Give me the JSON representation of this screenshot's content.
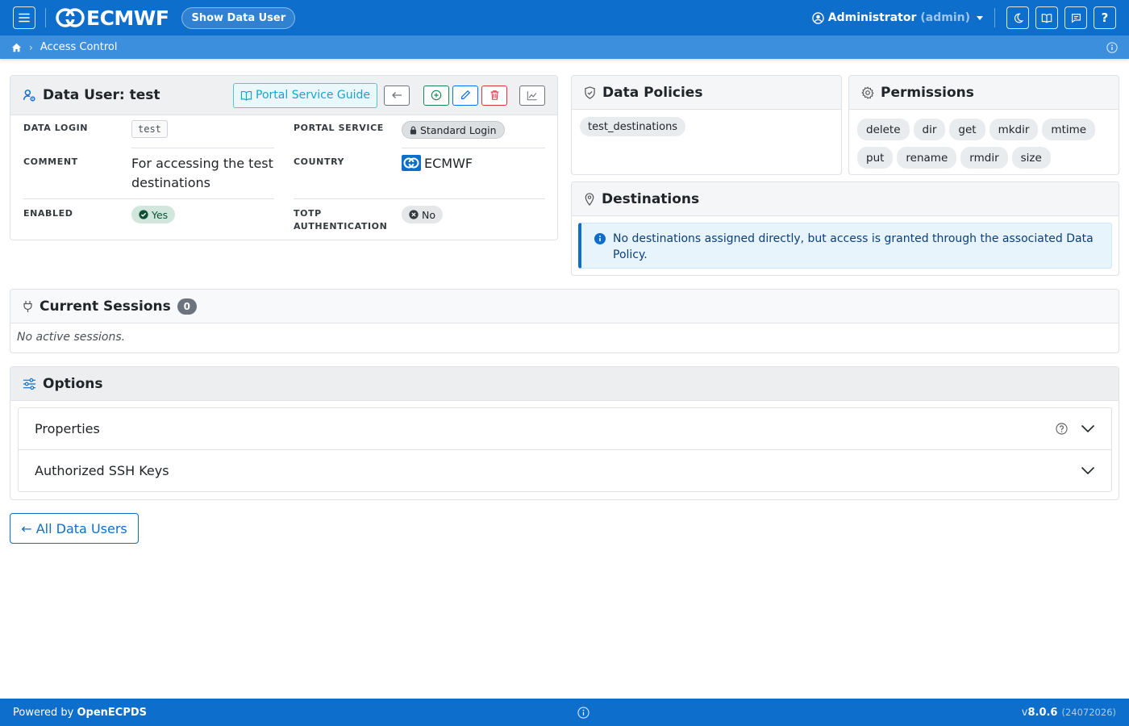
{
  "header": {
    "brand": "ECMWF",
    "page_pill": "Show Data User",
    "user_name": "Administrator",
    "user_role": "(admin)"
  },
  "breadcrumb": {
    "current": "Access Control"
  },
  "data_user": {
    "title": "Data User: test",
    "guide_label": "Portal Service Guide",
    "fields": {
      "data_login_label": "DATA LOGIN",
      "data_login_value": "test",
      "portal_service_label": "PORTAL SERVICE",
      "portal_service_value": "Standard Login",
      "comment_label": "COMMENT",
      "comment_value": "For accessing the test destinations",
      "country_label": "COUNTRY",
      "country_value": "ECMWF",
      "enabled_label": "ENABLED",
      "enabled_value": "Yes",
      "totp_label_1": "TOTP",
      "totp_label_2": "AUTHENTICATION",
      "totp_value": "No"
    }
  },
  "data_policies": {
    "title": "Data Policies",
    "items": [
      "test_destinations"
    ]
  },
  "permissions": {
    "title": "Permissions",
    "items": [
      "delete",
      "dir",
      "get",
      "mkdir",
      "mtime",
      "put",
      "rename",
      "rmdir",
      "size"
    ]
  },
  "destinations": {
    "title": "Destinations",
    "alert": "No destinations assigned directly, but access is granted through the associated Data Policy."
  },
  "sessions": {
    "title": "Current Sessions",
    "count": "0",
    "empty": "No active sessions."
  },
  "options": {
    "title": "Options",
    "properties_label": "Properties",
    "ssh_keys_label": "Authorized SSH Keys"
  },
  "back_button": "← All Data Users",
  "footer": {
    "powered_prefix": "Powered by ",
    "powered_name": "OpenECPDS",
    "version_prefix": "v",
    "version": "8.0.6",
    "build": "(24072026)"
  },
  "colors": {
    "primary": "#0d6ecb",
    "info": "#1aa3c8",
    "success": "#198754",
    "danger": "#dc3545"
  }
}
